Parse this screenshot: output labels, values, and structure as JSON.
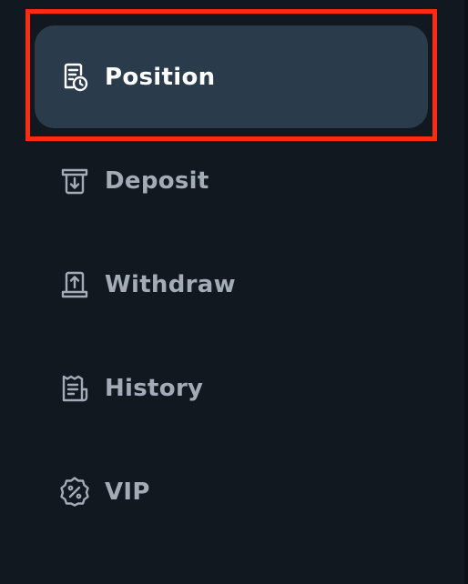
{
  "sidebar": {
    "items": [
      {
        "label": "Position",
        "icon": "receipt-clock-icon",
        "active": true
      },
      {
        "label": "Deposit",
        "icon": "deposit-icon",
        "active": false
      },
      {
        "label": "Withdraw",
        "icon": "withdraw-icon",
        "active": false
      },
      {
        "label": "History",
        "icon": "history-receipt-icon",
        "active": false
      },
      {
        "label": "VIP",
        "icon": "vip-badge-icon",
        "active": false
      }
    ]
  },
  "colors": {
    "background": "#111820",
    "active_item_background": "#2a3b4b",
    "active_text": "#ffffff",
    "inactive_text": "#a3abb6",
    "highlight_border": "#ff2a12"
  }
}
